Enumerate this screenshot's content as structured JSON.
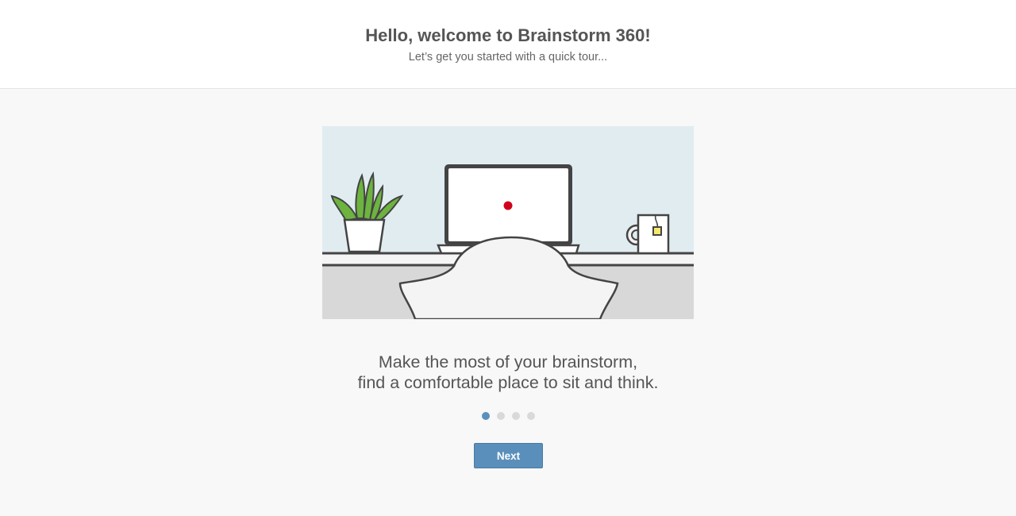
{
  "header": {
    "title": "Hello, welcome to Brainstorm 360!",
    "subtitle": "Let’s get you started with a quick tour..."
  },
  "slide": {
    "caption_line1": "Make the most of your brainstorm,",
    "caption_line2": "find a comfortable place to sit and think."
  },
  "pagination": {
    "total": 4,
    "current": 1
  },
  "actions": {
    "next_label": "Next"
  },
  "colors": {
    "accent": "#5a8fbb",
    "active_dot": "#5b8fbd",
    "inactive_dot": "#d9d9d9",
    "plant_green": "#6db33f",
    "record_dot": "#d0021b",
    "tea_tag": "#f3e96b"
  }
}
